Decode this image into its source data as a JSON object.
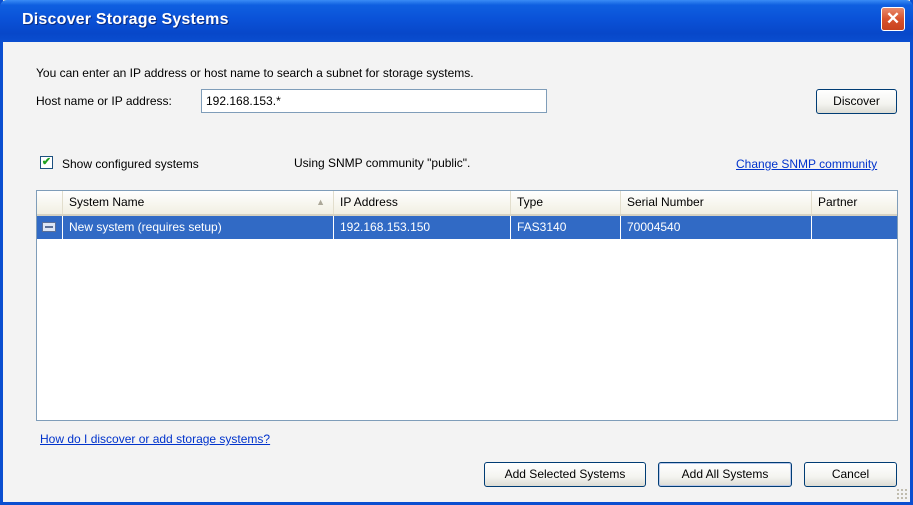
{
  "window": {
    "title": "Discover Storage Systems",
    "close_glyph": "✕"
  },
  "intro_text": "You can enter an IP address or host name to search a subnet for storage systems.",
  "host": {
    "label": "Host name or IP address:",
    "value": "192.168.153.*"
  },
  "discover_button": "Discover",
  "show_configured": {
    "label": "Show configured systems",
    "checked": true,
    "check_glyph": "✔"
  },
  "snmp_status": "Using SNMP community \"public\".",
  "change_snmp_link": "Change SNMP community",
  "table": {
    "columns": [
      "System Name",
      "IP Address",
      "Type",
      "Serial Number",
      "Partner"
    ],
    "sorted_column": "System Name",
    "sort_glyph": "▲",
    "rows": [
      {
        "icon": "storage-system-icon",
        "system_name": "New system (requires setup)",
        "ip_address": "192.168.153.150",
        "type": "FAS3140",
        "serial_number": "70004540",
        "partner": "",
        "selected": true
      }
    ]
  },
  "help_link": "How do I discover or add storage systems?",
  "buttons": {
    "add_selected": "Add Selected Systems",
    "add_all": "Add All Systems",
    "cancel": "Cancel"
  },
  "colors": {
    "title_bar": "#0a4ed0",
    "selection": "#316ac5",
    "link": "#0033cc"
  }
}
